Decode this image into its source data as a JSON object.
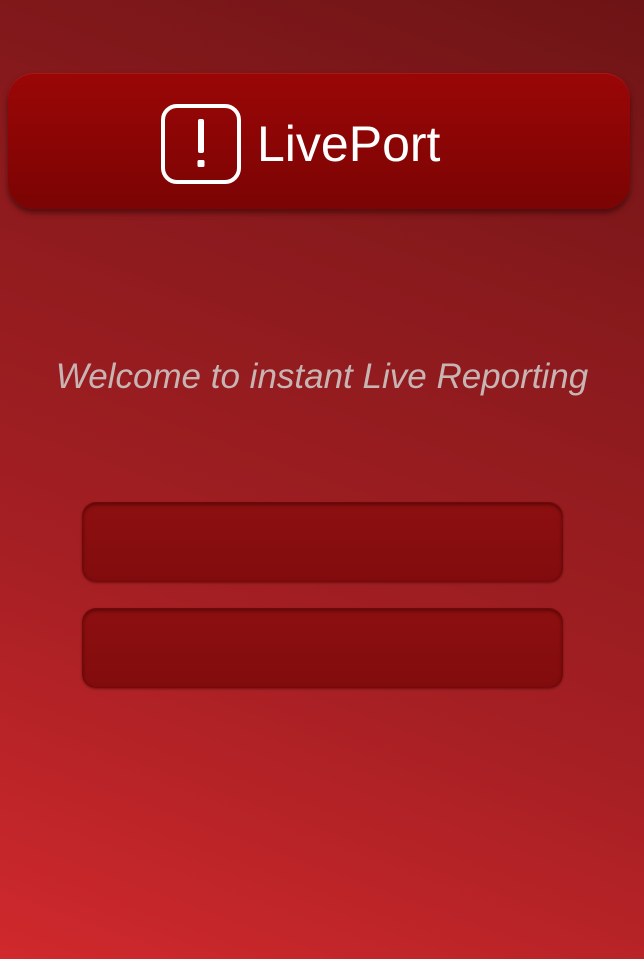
{
  "app": {
    "name": "LivePort",
    "icon": "exclamation-icon"
  },
  "welcome_text": "Welcome to instant Live Reporting",
  "fields": [
    {
      "value": "",
      "placeholder": ""
    },
    {
      "value": "",
      "placeholder": ""
    }
  ],
  "colors": {
    "header": "#8a0505",
    "field": "#880e0f",
    "welcome_text": "#c9b4b4",
    "background_top": "#6e1416",
    "background_bottom": "#d0292d"
  }
}
